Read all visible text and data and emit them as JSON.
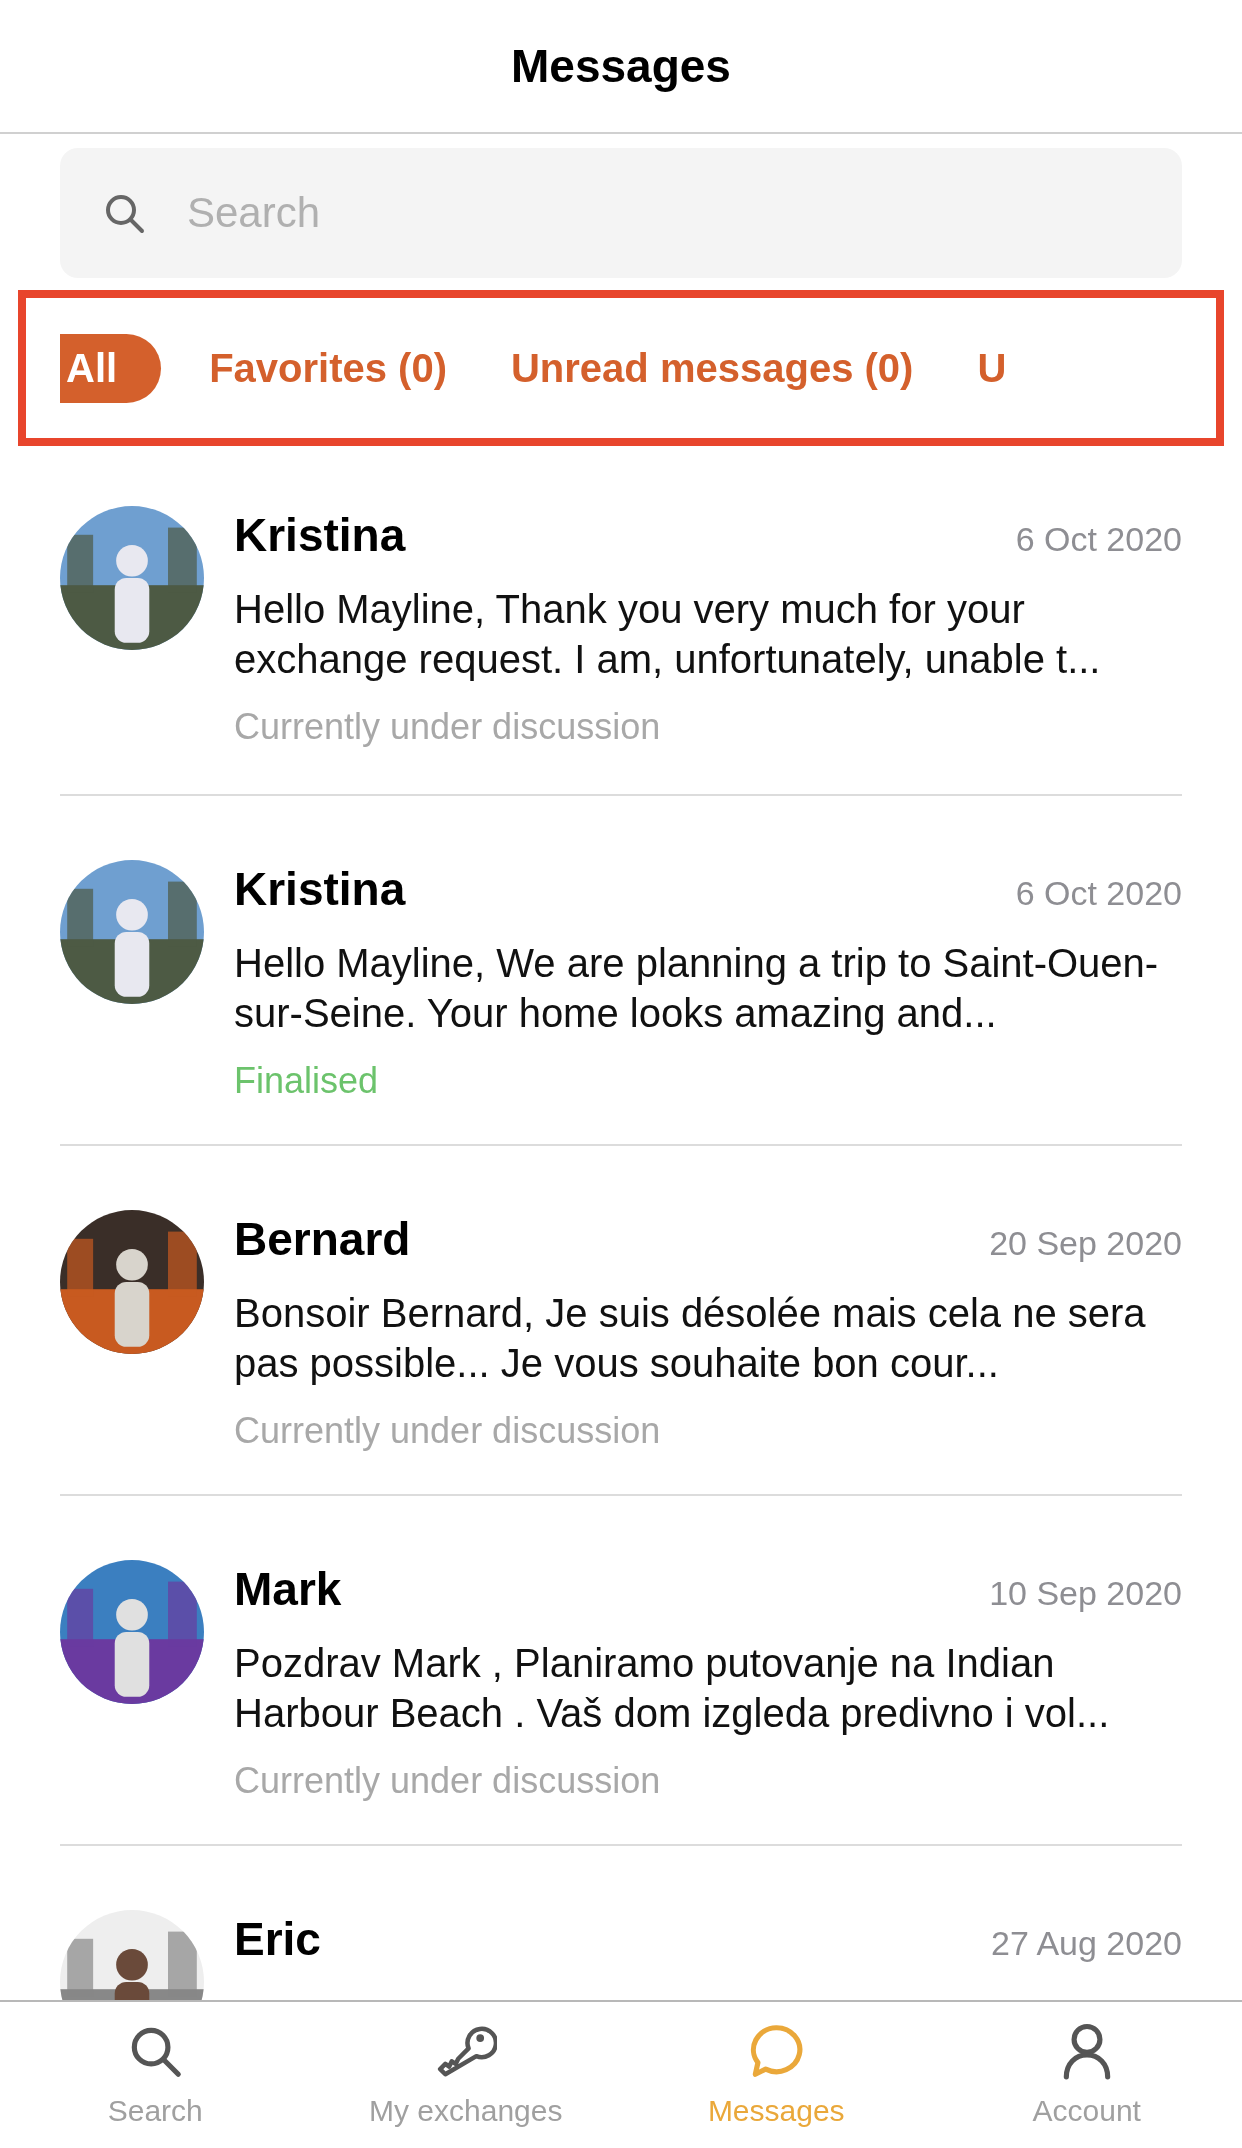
{
  "header": {
    "title": "Messages"
  },
  "search": {
    "placeholder": "Search"
  },
  "filters": [
    {
      "label": "All",
      "selected": true
    },
    {
      "label": "Favorites (0)",
      "selected": false
    },
    {
      "label": "Unread messages (0)",
      "selected": false
    },
    {
      "label": "U",
      "selected": false
    }
  ],
  "conversations": [
    {
      "name": "Kristina",
      "date": "6 Oct 2020",
      "message": "Hello Mayline, Thank you very much for your exchange request. I am, unfortunately, unable t...",
      "status": "Currently under discussion",
      "kind": "open"
    },
    {
      "name": "Kristina",
      "date": "6 Oct 2020",
      "message": "Hello Mayline,  We are planning a trip to Saint-Ouen-sur-Seine. Your home looks amazing and...",
      "status": "Finalised",
      "kind": "done"
    },
    {
      "name": "Bernard",
      "date": "20 Sep 2020",
      "message": "Bonsoir Bernard, Je suis désolée mais cela ne sera pas possible... Je vous souhaite bon cour...",
      "status": "Currently under discussion",
      "kind": "open"
    },
    {
      "name": "Mark",
      "date": "10 Sep 2020",
      "message": "Pozdrav Mark ,  Planiramo putovanje na Indian Harbour Beach . Vaš dom izgleda predivno i vol...",
      "status": "Currently under discussion",
      "kind": "open"
    },
    {
      "name": "Eric",
      "date": "27 Aug 2020"
    }
  ],
  "tabbar": [
    {
      "label": "Search",
      "selected": false
    },
    {
      "label": "My exchanges",
      "selected": false
    },
    {
      "label": "Messages",
      "selected": true
    },
    {
      "label": "Account",
      "selected": false
    }
  ]
}
